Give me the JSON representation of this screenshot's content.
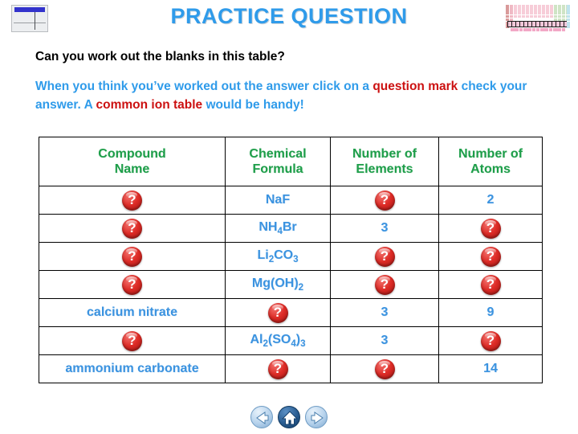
{
  "title": "PRACTICE QUESTION",
  "icons": {
    "table_icon": "table-window-icon",
    "periodic_icon": "periodic-table-icon"
  },
  "intro": {
    "line1": "Can you work out the blanks in this table?"
  },
  "instructions": {
    "seg1": "When you think you’ve worked out the answer click on a ",
    "seg2_highlight": "question mark",
    "seg3": " check your answer. A ",
    "seg4_highlight": "common ion table",
    "seg5": " would be handy!"
  },
  "colors": {
    "title_blue": "#2f9bea",
    "text_blue": "#3b93e0",
    "header_green": "#1e9e4a",
    "highlight_red": "#cc1111",
    "qmark_red": "#dd2b26"
  },
  "table": {
    "headers": [
      "Compound Name",
      "Chemical Formula",
      "Number of Elements",
      "Number of Atoms"
    ],
    "header_lines": [
      [
        "Compound",
        "Name"
      ],
      [
        "Chemical",
        "Formula"
      ],
      [
        "Number of",
        "Elements"
      ],
      [
        "Number of",
        "Atoms"
      ]
    ],
    "rows": [
      {
        "compound_name": "?",
        "formula_html": "NaF",
        "elements": "?",
        "atoms": "2"
      },
      {
        "compound_name": "?",
        "formula_html": "NH<sub>4</sub>Br",
        "elements": "3",
        "atoms": "?"
      },
      {
        "compound_name": "?",
        "formula_html": "Li<sub>2</sub>CO<sub>3</sub>",
        "elements": "?",
        "atoms": "?"
      },
      {
        "compound_name": "?",
        "formula_html": "Mg(OH)<sub>2</sub>",
        "elements": "?",
        "atoms": "?"
      },
      {
        "compound_name": "calcium nitrate",
        "formula_html": "?",
        "elements": "3",
        "atoms": "9"
      },
      {
        "compound_name": "?",
        "formula_html": "Al<sub>2</sub>(SO<sub>4</sub>)<sub>3</sub>",
        "elements": "3",
        "atoms": "?"
      },
      {
        "compound_name": "ammonium carbonate",
        "formula_html": "?",
        "elements": "?",
        "atoms": "14"
      }
    ]
  },
  "nav": {
    "back_label": "back-arrow-icon",
    "home_label": "home-icon",
    "forward_label": "forward-arrow-icon"
  }
}
